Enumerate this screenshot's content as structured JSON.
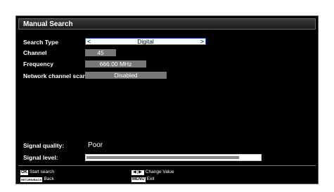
{
  "title": "Manual Search",
  "rows": {
    "search_type": {
      "label": "Search Type",
      "value": "Digital",
      "arrow_left": "<",
      "arrow_right": ">"
    },
    "channel": {
      "label": "Channel",
      "value": "45"
    },
    "frequency": {
      "label": "Frequency",
      "value": "666.00 MHz"
    },
    "network_scan": {
      "label": "Network channel scan",
      "value": "Disabled"
    }
  },
  "signal": {
    "quality_label": "Signal quality:",
    "quality_value": "Poor",
    "level_label": "Signal level:",
    "level_fraction": 0.88
  },
  "footer": {
    "ok_key": "OK",
    "start_search": "Start search",
    "back_key": "RETURN/BACK",
    "back": "Back",
    "arrows_key": "◀|▶",
    "change_value": "Change Value",
    "menu_key": "MENU",
    "exit": "Exit"
  },
  "colors": {
    "selected_border": "#3060c0",
    "value_box": "#777777",
    "background": "#000000"
  }
}
